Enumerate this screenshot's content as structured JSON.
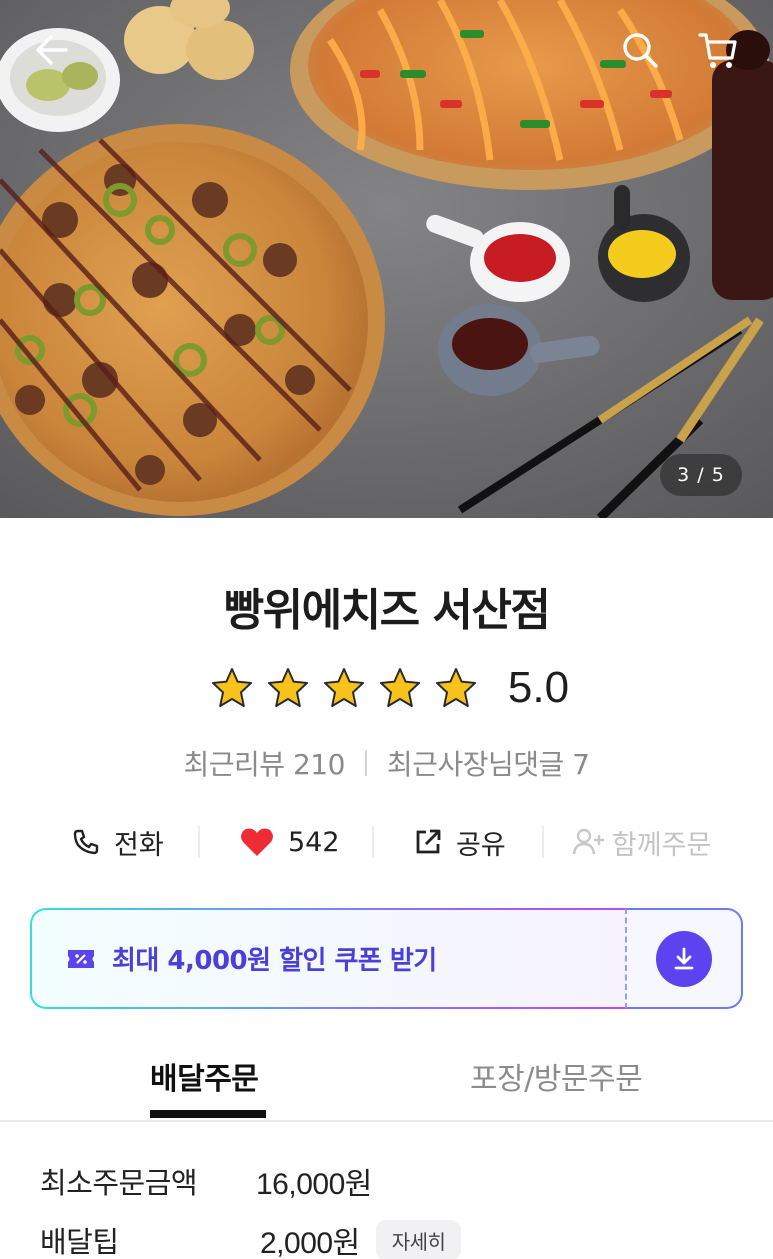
{
  "hero": {
    "page_indicator": "3 / 5",
    "icons": [
      "back-arrow-icon",
      "search-icon",
      "cart-icon"
    ]
  },
  "store": {
    "name": "빵위에치즈 서산점",
    "rating_stars": 5,
    "rating_value": "5.0",
    "recent_reviews": "최근리뷰 210",
    "owner_replies": "최근사장님댓글 7"
  },
  "actions": {
    "call": "전화",
    "likes": "542",
    "share": "공유",
    "group_order": "함께주문"
  },
  "coupon": {
    "label": "최대 4,000원 할인 쿠폰 받기",
    "icon": "coupon-icon",
    "download_icon": "download-icon"
  },
  "tabs": [
    {
      "label": "배달주문",
      "active": true
    },
    {
      "label": "포장/방문주문",
      "active": false
    }
  ],
  "delivery_info": {
    "min_order_label": "최소주문금액",
    "min_order_value": "16,000원",
    "tip_label": "배달팁",
    "tip_value": "2,000원",
    "detail_button": "자세히"
  },
  "colors": {
    "accent": "#5b44f0",
    "coupon_text": "#4a3fd8",
    "star": "#f7c21c",
    "heart": "#ef2b35"
  }
}
